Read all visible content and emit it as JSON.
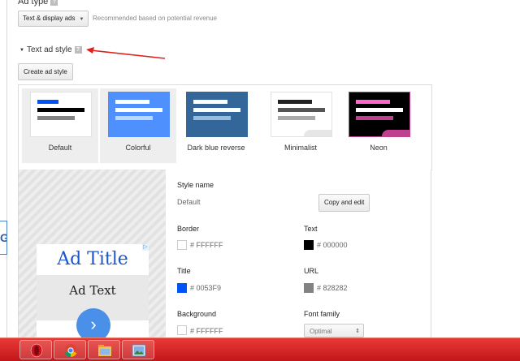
{
  "ad_type": {
    "label": "Ad type",
    "selected": "Text & display ads",
    "hint": "Recommended based on potential revenue"
  },
  "text_ad_style": {
    "header": "Text ad style",
    "help_icon": "help-icon",
    "create_button": "Create ad style"
  },
  "styles": [
    {
      "name": "Default",
      "selected": true,
      "bg": "#ffffff",
      "title_color": "#0053F9",
      "text_color": "#000000",
      "url_color": "#828282"
    },
    {
      "name": "Colorful",
      "selected": false,
      "bg": "#4d90fe",
      "title_color": "#ffffff",
      "text_color": "#ffffff",
      "url_color": "#bcd6ff"
    },
    {
      "name": "Dark blue reverse",
      "selected": false,
      "bg": "#336699",
      "title_color": "#ffffff",
      "text_color": "#ffffff",
      "url_color": "#99bbdd"
    },
    {
      "name": "Minimalist",
      "selected": false,
      "bg": "#ffffff",
      "title_color": "#222222",
      "text_color": "#555555",
      "url_color": "#aaaaaa"
    },
    {
      "name": "Neon",
      "selected": false,
      "bg": "#000000",
      "title_color": "#ff66cc",
      "text_color": "#ffffff",
      "url_color": "#c04090"
    }
  ],
  "preview": {
    "ad_title": "Ad Title",
    "ad_text": "Ad Text",
    "adchoices_icon": "adchoices-icon",
    "next_icon": "chevron-right-icon",
    "next_symbol": "›"
  },
  "settings": {
    "style_name_label": "Style name",
    "style_name_value": "Default",
    "copy_button": "Copy and edit",
    "border_label": "Border",
    "border_value": "# FFFFFF",
    "border_color": "#FFFFFF",
    "text_label": "Text",
    "text_value": "# 000000",
    "text_color": "#000000",
    "title_label": "Title",
    "title_value": "# 0053F9",
    "title_color": "#0053F9",
    "url_label": "URL",
    "url_value": "# 828282",
    "url_color": "#828282",
    "background_label": "Background",
    "background_value": "# FFFFFF",
    "background_color": "#FFFFFF",
    "font_label": "Font family",
    "font_value": "Optimal"
  },
  "taskbar": {
    "start_letter": "G",
    "apps": [
      "opera-icon",
      "chrome-icon",
      "file-explorer-icon",
      "photo-viewer-icon"
    ]
  }
}
